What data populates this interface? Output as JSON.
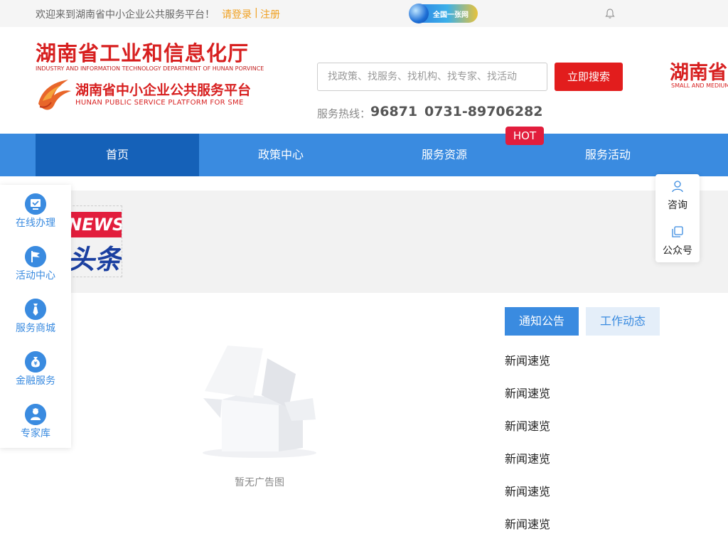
{
  "topbar": {
    "welcome": "欢迎来到湖南省中小企业公共服务平台！",
    "login": "请登录",
    "separator": "|",
    "register": "注册",
    "network_badge": "全国一张网"
  },
  "header": {
    "logo_title": "湖南省工业和信息化厅",
    "logo_title_en": "INDUSTRY AND INFORMATION TECHNOLOGY DEPARTMENT OF HUNAN PORVINCE",
    "platform_title": "湖南省中小企业公共服务平台",
    "platform_title_en": "HUNAN PUBLIC SERVICE PLATFORM FOR SME",
    "search_placeholder": "找政策、找服务、找机构、找专家、找活动",
    "search_button": "立即搜索",
    "hotline_label": "服务热线：",
    "hotline_1": "96871",
    "hotline_2": "0731-89706282",
    "right_logo": "湖南省",
    "right_logo_en": "SMALL AND MEDIUM"
  },
  "nav": {
    "items": [
      {
        "label": "首页"
      },
      {
        "label": "政策中心"
      },
      {
        "label": "服务资源"
      },
      {
        "label": "服务活动"
      }
    ],
    "hot_badge": "HOT"
  },
  "banner": {
    "news_logo_en": "NEWS",
    "news_logo_cn": "头条"
  },
  "sidebar_left": [
    {
      "label": "在线办理",
      "icon": "monitor-check-icon"
    },
    {
      "label": "活动中心",
      "icon": "flag-icon"
    },
    {
      "label": "服务商城",
      "icon": "tie-icon"
    },
    {
      "label": "金融服务",
      "icon": "money-bag-icon"
    },
    {
      "label": "专家库",
      "icon": "expert-icon"
    }
  ],
  "sidebar_right": [
    {
      "label": "咨询",
      "icon": "user-icon"
    },
    {
      "label": "公众号",
      "icon": "copy-icon"
    }
  ],
  "ad": {
    "empty_text": "暂无广告图"
  },
  "news_tabs": [
    {
      "label": "通知公告"
    },
    {
      "label": "工作动态"
    }
  ],
  "news_list": [
    "新闻速览",
    "新闻速览",
    "新闻速览",
    "新闻速览",
    "新闻速览",
    "新闻速览"
  ],
  "colors": {
    "primary": "#3a8be0",
    "nav_active": "#1561b8",
    "brand_red": "#d71f1f",
    "accent_orange": "#f0a020"
  }
}
